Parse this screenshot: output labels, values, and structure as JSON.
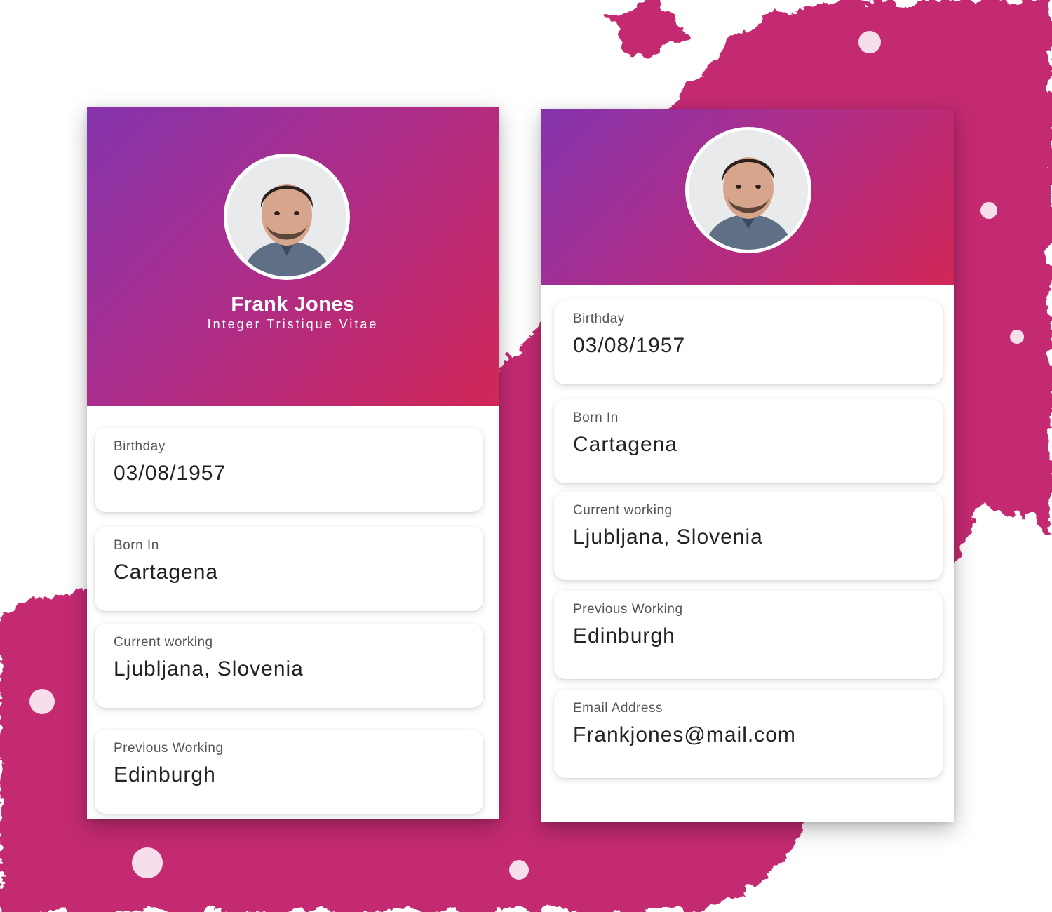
{
  "colors": {
    "gradient_start": "#8434ad",
    "gradient_end": "#d02857",
    "paint": "#c32a72",
    "card_background": "#ffffff",
    "label_text": "#555555",
    "value_text": "#222222"
  },
  "left_card": {
    "avatar_icon": "person-photo-icon",
    "name": "Frank Jones",
    "subtitle": "Integer Tristique Vitae",
    "fields": [
      {
        "label": "Birthday",
        "value": "03/08/1957"
      },
      {
        "label": "Born In",
        "value": "Cartagena"
      },
      {
        "label": "Current working",
        "value": "Ljubljana, Slovenia"
      },
      {
        "label": "Previous Working",
        "value": "Edinburgh"
      }
    ]
  },
  "right_card": {
    "avatar_icon": "person-photo-icon",
    "fields": [
      {
        "label": "Birthday",
        "value": "03/08/1957"
      },
      {
        "label": "Born In",
        "value": "Cartagena"
      },
      {
        "label": "Current working",
        "value": "Ljubljana, Slovenia"
      },
      {
        "label": "Previous Working",
        "value": "Edinburgh"
      },
      {
        "label": "Email Address",
        "value": "Frankjones@mail.com"
      }
    ]
  }
}
